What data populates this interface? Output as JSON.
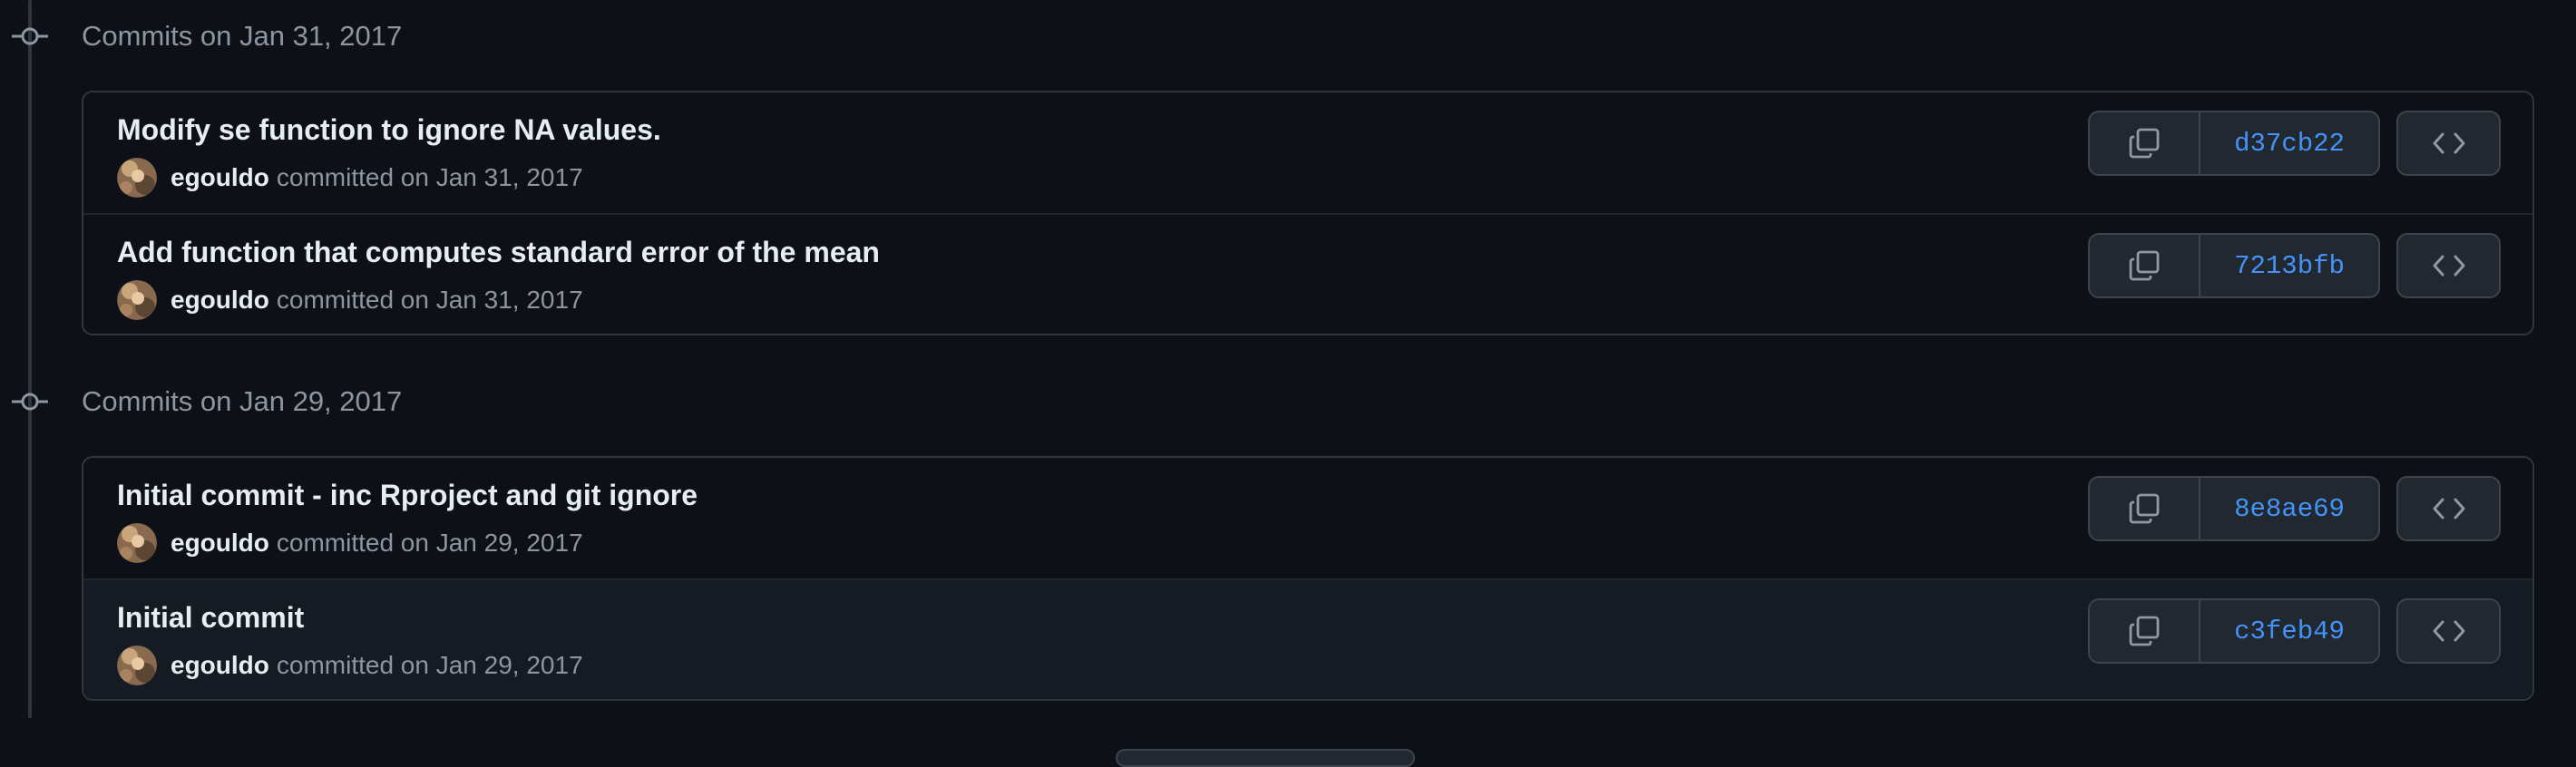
{
  "groups": [
    {
      "title": "Commits on Jan 31, 2017",
      "commits": [
        {
          "message": "Modify se function to ignore NA values.",
          "author": "egouldo",
          "committed": "committed on Jan 31, 2017",
          "sha": "d37cb22"
        },
        {
          "message": "Add function that computes standard error of the mean",
          "author": "egouldo",
          "committed": "committed on Jan 31, 2017",
          "sha": "7213bfb"
        }
      ]
    },
    {
      "title": "Commits on Jan 29, 2017",
      "commits": [
        {
          "message": "Initial commit - inc Rproject and git ignore",
          "author": "egouldo",
          "committed": "committed on Jan 29, 2017",
          "sha": "8e8ae69"
        },
        {
          "message": "Initial commit",
          "author": "egouldo",
          "committed": "committed on Jan 29, 2017",
          "sha": "c3feb49"
        }
      ]
    }
  ],
  "icons": {
    "commit_marker": "git-commit-icon",
    "copy": "copy-icon",
    "browse": "code-icon",
    "avatar": "avatar"
  },
  "colors": {
    "background": "#0d1117",
    "border": "#30363d",
    "muted_text": "#8d96a0",
    "link": "#4493f8",
    "button_bg": "#212830"
  }
}
